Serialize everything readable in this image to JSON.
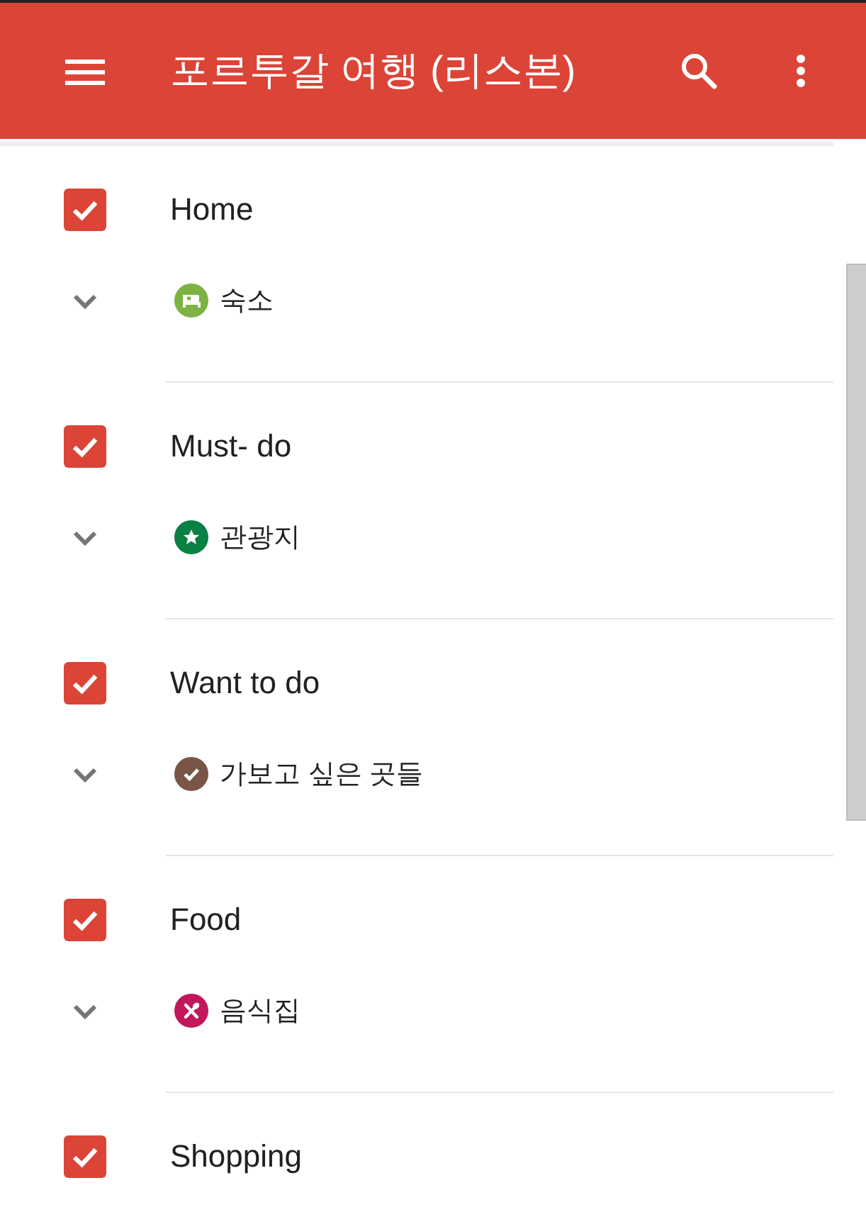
{
  "app_bar": {
    "title": "포르투갈 여행 (리스본)"
  },
  "layers": [
    {
      "name": "Home",
      "checked": true,
      "style": {
        "kind": "bed",
        "color": "#7cb342",
        "label": "숙소"
      }
    },
    {
      "name": "Must- do",
      "checked": true,
      "style": {
        "kind": "star",
        "color": "#0b8043",
        "label": "관광지"
      }
    },
    {
      "name": "Want to do",
      "checked": true,
      "style": {
        "kind": "check",
        "color": "#795548",
        "label": "가보고 싶은 곳들"
      }
    },
    {
      "name": "Food",
      "checked": true,
      "style": {
        "kind": "utensils",
        "color": "#c2185b",
        "label": "음식집"
      }
    },
    {
      "name": "Shopping",
      "checked": true
    }
  ]
}
